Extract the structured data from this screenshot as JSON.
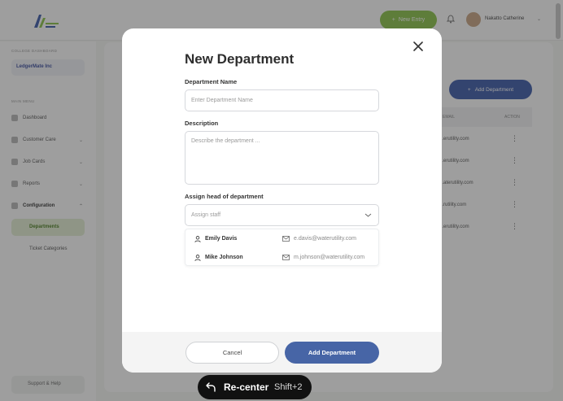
{
  "header": {
    "new_entry_label": "New Entry",
    "user_name": "Nakatto Catherine"
  },
  "sidebar": {
    "college_caption": "COLLEGE DASHBOARD",
    "org_name": "LedgerMate Inc",
    "menu_caption": "MAIN MENU",
    "items": [
      {
        "label": "Dashboard"
      },
      {
        "label": "Customer Care"
      },
      {
        "label": "Job Cards"
      },
      {
        "label": "Reports"
      },
      {
        "label": "Configuration"
      }
    ],
    "sub_items": [
      {
        "label": "Departments"
      },
      {
        "label": "Ticket Categories"
      }
    ],
    "support_label": "Support & Help"
  },
  "background": {
    "add_department_label": "Add Department",
    "table_headers": [
      "EMAIL",
      "ACTION"
    ],
    "row_emails": [
      "...erutility.com",
      "...erutility.com",
      "...aterutility.com",
      "...rutility.com",
      "...erutility.com"
    ]
  },
  "modal": {
    "title": "New Department",
    "name_label": "Department Name",
    "name_placeholder": "Enter Department Name",
    "description_label": "Description",
    "description_placeholder": "Describe the department ...",
    "head_label": "Assign head of department",
    "head_placeholder": "Assign staff",
    "staff": [
      {
        "name": "Emily Davis",
        "email": "e.davis@waterutility.com"
      },
      {
        "name": "Mike Johnson",
        "email": "m.johnson@waterutility.com"
      }
    ],
    "cancel_label": "Cancel",
    "submit_label": "Add Department"
  },
  "recenter": {
    "label": "Re-center",
    "shortcut": "Shift+2"
  },
  "colors": {
    "accent_green": "#8bc34a",
    "primary_blue": "#4765a6",
    "overlay": "#282828"
  }
}
